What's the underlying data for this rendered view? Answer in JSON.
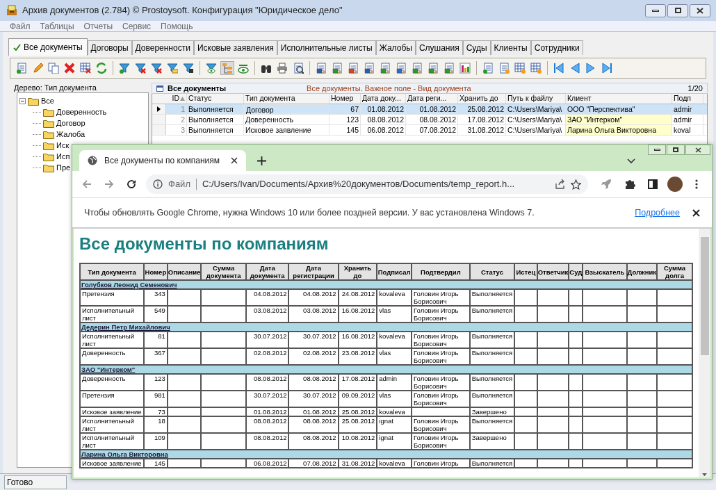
{
  "window": {
    "title": "Архив документов (2.784) © Prostoysoft. Конфигурация \"Юридическое дело\""
  },
  "menu": [
    "Файл",
    "Таблицы",
    "Отчеты",
    "Сервис",
    "Помощь"
  ],
  "tabs": [
    {
      "label": "Все документы",
      "selected": true
    },
    {
      "label": "Договоры",
      "selected": false
    },
    {
      "label": "Доверенности",
      "selected": false
    },
    {
      "label": "Исковые заявления",
      "selected": false
    },
    {
      "label": "Исполнительные листы",
      "selected": false
    },
    {
      "label": "Жалобы",
      "selected": false
    },
    {
      "label": "Слушания",
      "selected": false
    },
    {
      "label": "Суды",
      "selected": false
    },
    {
      "label": "Клиенты",
      "selected": false
    },
    {
      "label": "Сотрудники",
      "selected": false
    }
  ],
  "tree": {
    "title": "Дерево: Тип документа",
    "items": [
      {
        "label": "Все",
        "expanded": true,
        "children": [
          {
            "label": "Доверенность"
          },
          {
            "label": "Договор"
          },
          {
            "label": "Жалоба"
          },
          {
            "label": "Иск"
          },
          {
            "label": "Исп"
          },
          {
            "label": "Пре"
          }
        ]
      }
    ]
  },
  "grid": {
    "title": "Все документы",
    "hint": "Все документы. Важное поле - Вид документа",
    "counter": "1/20",
    "columns": [
      {
        "label": "ID",
        "sorted": true
      },
      {
        "label": "Статус",
        "sorted": false
      },
      {
        "label": "Тип документа",
        "sorted": false
      },
      {
        "label": "Номер",
        "sorted": false
      },
      {
        "label": "Дата доку...",
        "sorted": false
      },
      {
        "label": "Дата реги...",
        "sorted": false
      },
      {
        "label": "Хранить до",
        "sorted": false
      },
      {
        "label": "Путь к файлу",
        "sorted": false
      },
      {
        "label": "Клиент",
        "sorted": false
      },
      {
        "label": "Подп",
        "sorted": false
      }
    ],
    "rows": [
      {
        "selected": true,
        "highlighted": false,
        "cells": [
          "1",
          "Выполняется",
          "Договор",
          "67",
          "01.08.2012",
          "01.08.2012",
          "25.08.2012",
          "C:\\Users\\Mariya\\",
          "ООО \"Перспектива\"",
          "admir"
        ]
      },
      {
        "selected": false,
        "highlighted": true,
        "cells": [
          "2",
          "Выполняется",
          "Доверенность",
          "123",
          "08.08.2012",
          "08.08.2012",
          "17.08.2012",
          "C:\\Users\\Mariya\\",
          "ЗАО \"Интерком\"",
          "admir"
        ]
      },
      {
        "selected": false,
        "highlighted": true,
        "cells": [
          "3",
          "Выполняется",
          "Исковое заявление",
          "145",
          "06.08.2012",
          "07.08.2012",
          "31.08.2012",
          "C:\\Users\\Mariya\\",
          "Ларина Ольга Викторовна",
          "koval"
        ]
      }
    ]
  },
  "status_bar": {
    "text": "Готово"
  },
  "browser": {
    "tab_title": "Все документы по компаниям",
    "address_label": "Файл",
    "url": "C:/Users/Ivan/Documents/Архив%20документов/Documents/temp_report.h...",
    "infobar": {
      "text": "Чтобы обновлять Google Chrome, нужна Windows 10 или более поздней версии. У вас установлена Windows 7.",
      "link": "Подробнее"
    },
    "report": {
      "title": "Все документы по компаниям",
      "columns": [
        "Тип документа",
        "Номер",
        "Описание",
        "Сумма документа",
        "Дата документа",
        "Дата регистрации",
        "Хранить до",
        "Подписал",
        "Подтвердил",
        "Статус",
        "Истец",
        "Ответчик",
        "Суд",
        "Взыскатель",
        "Должник",
        "Сумма долга"
      ],
      "groups": [
        {
          "name": "Голубков Леонид Семенович",
          "rows": [
            [
              "Претензия",
              "343",
              "",
              "",
              "04.08.2012",
              "04.08.2012",
              "24.08.2012",
              "kovaleva",
              "Головин Игорь Борисович",
              "Выполняется",
              "",
              "",
              "",
              "",
              "",
              ""
            ],
            [
              "Исполнительный лист",
              "549",
              "",
              "",
              "03.08.2012",
              "03.08.2012",
              "16.08.2012",
              "vlas",
              "Головин Игорь Борисович",
              "Выполняется",
              "",
              "",
              "",
              "",
              "",
              ""
            ]
          ]
        },
        {
          "name": "Дедерин Петр Михайлович",
          "rows": [
            [
              "Исполнительный лист",
              "81",
              "",
              "",
              "30.07.2012",
              "30.07.2012",
              "16.08.2012",
              "kovaleva",
              "Головин Игорь Борисович",
              "Выполняется",
              "",
              "",
              "",
              "",
              "",
              ""
            ],
            [
              "Доверенность",
              "367",
              "",
              "",
              "02.08.2012",
              "02.08.2012",
              "23.08.2012",
              "vlas",
              "Головин Игорь Борисович",
              "Выполняется",
              "",
              "",
              "",
              "",
              "",
              ""
            ]
          ]
        },
        {
          "name": "ЗАО \"Интерком\"",
          "rows": [
            [
              "Доверенность",
              "123",
              "",
              "",
              "08.08.2012",
              "08.08.2012",
              "17.08.2012",
              "admin",
              "Головин Игорь Борисович",
              "Выполняется",
              "",
              "",
              "",
              "",
              "",
              ""
            ],
            [
              "Претензия",
              "981",
              "",
              "",
              "30.07.2012",
              "30.07.2012",
              "09.09.2012",
              "vlas",
              "Головин Игорь Борисович",
              "Выполняется",
              "",
              "",
              "",
              "",
              "",
              ""
            ],
            [
              "Исковое заявление",
              "73",
              "",
              "",
              "01.08.2012",
              "01.08.2012",
              "25.08.2012",
              "kovaleva",
              "",
              "Завершено",
              "",
              "",
              "",
              "",
              "",
              ""
            ],
            [
              "Исполнительный лист",
              "18",
              "",
              "",
              "08.08.2012",
              "08.08.2012",
              "25.08.2012",
              "ignat",
              "Головин Игорь Борисович",
              "Выполняется",
              "",
              "",
              "",
              "",
              "",
              ""
            ],
            [
              "Исполнительный лист",
              "109",
              "",
              "",
              "08.08.2012",
              "08.08.2012",
              "10.08.2012",
              "ignat",
              "Головин Игорь Борисович",
              "Завершено",
              "",
              "",
              "",
              "",
              "",
              ""
            ]
          ]
        },
        {
          "name": "Ларина Ольга Викторовна",
          "rows": [
            [
              "Исковое заявление",
              "145",
              "",
              "",
              "06.08.2012",
              "07.08.2012",
              "31.08.2012",
              "kovaleva",
              "Головин Игорь",
              "Выполняется",
              "",
              "",
              "",
              "",
              "",
              ""
            ]
          ]
        }
      ]
    }
  }
}
